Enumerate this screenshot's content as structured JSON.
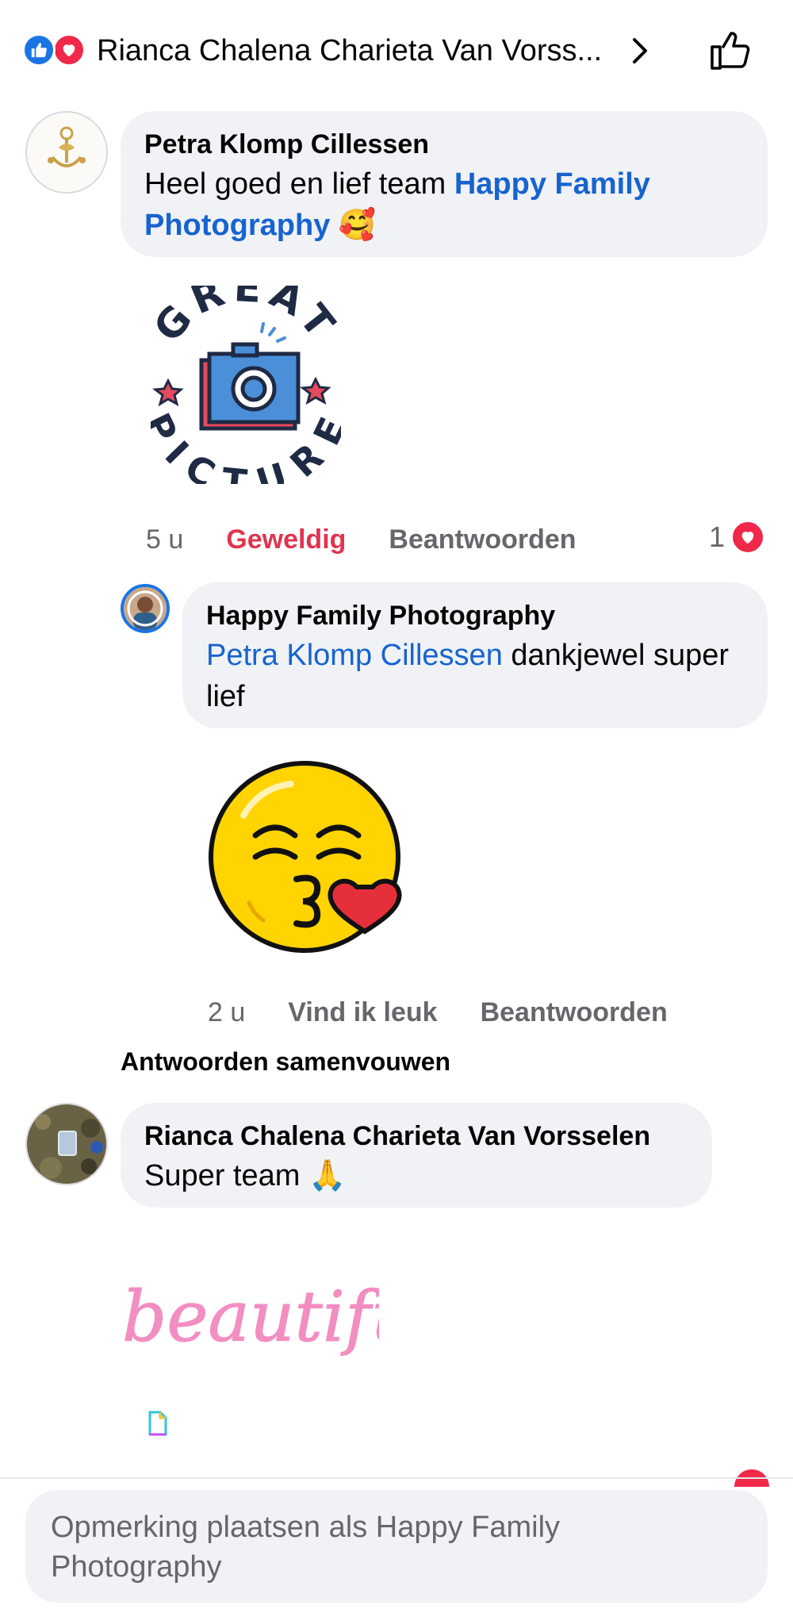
{
  "header": {
    "title": "Rianca Chalena Charieta Van Vorss...",
    "reaction_icons": [
      "like-icon",
      "love-icon"
    ],
    "chevron_icon": "chevron-right-icon",
    "like_icon": "thumbs-up-icon"
  },
  "comments": [
    {
      "author": "Petra Klomp Cillessen",
      "text_prefix": "Heel goed en lief team ",
      "mention": "Happy Family Photography",
      "text_suffix": " 🥰",
      "sticker": "great-picture-sticker",
      "sticker_text_top": "GREAT",
      "sticker_text_bottom": "PICTURE",
      "time": "5 u",
      "reaction_label": "Geweldig",
      "reply_label": "Beantwoorden",
      "reaction_count": "1"
    },
    {
      "author": "Happy Family Photography",
      "mention": "Petra Klomp Cillessen",
      "text_suffix": " dankjewel super lief",
      "sticker": "kiss-face-sticker",
      "time": "2 u",
      "like_label": "Vind ik leuk",
      "reply_label": "Beantwoorden"
    },
    {
      "author": "Rianca Chalena Charieta Van Vorsselen",
      "text": "Super team 🙏",
      "sticker": "beautiful-sticker",
      "sticker_text": "beautiful"
    }
  ],
  "collapse_label": "Antwoorden samenvouwen",
  "composer": {
    "placeholder": "Opmerking plaatsen als Happy Family Photography"
  },
  "colors": {
    "mention_blue": "#1763cf",
    "love_red": "#f0284a",
    "bubble_bg": "#f0f2f5",
    "secondary_text": "#65676b"
  }
}
